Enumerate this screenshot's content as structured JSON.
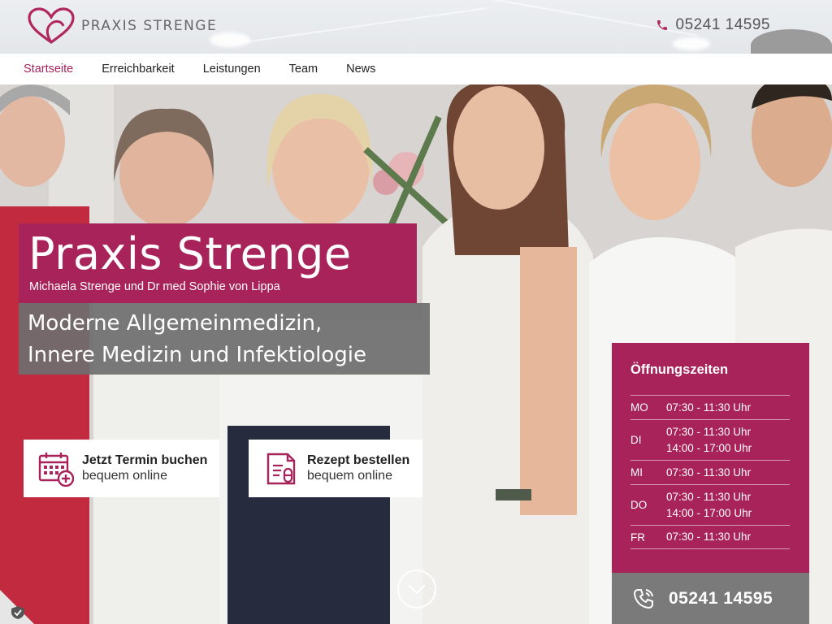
{
  "brand": {
    "name": "PRAXIS STRENGE",
    "accent": "#a8235a",
    "gray": "#6e6e6e"
  },
  "header": {
    "phone": "05241 14595",
    "phone_icon": "phone-icon"
  },
  "nav": {
    "items": [
      {
        "label": "Startseite",
        "active": true
      },
      {
        "label": "Erreichbarkeit",
        "active": false
      },
      {
        "label": "Leistungen",
        "active": false
      },
      {
        "label": "Team",
        "active": false
      },
      {
        "label": "News",
        "active": false
      }
    ]
  },
  "hero": {
    "title": "Praxis Strenge",
    "subtitle": "Michaela Strenge und Dr med Sophie von Lippa",
    "tagline": [
      "Moderne Allgemeinmedizin,",
      "Innere Medizin und Infektiologie"
    ]
  },
  "cta": {
    "appointment": {
      "title": "Jetzt Termin buchen",
      "subtitle": "bequem online",
      "icon": "calendar-plus-icon"
    },
    "prescription": {
      "title": "Rezept bestellen",
      "subtitle": "bequem online",
      "icon": "prescription-icon"
    }
  },
  "hours": {
    "title": "Öffnungszeiten",
    "rows": [
      {
        "day": "MO",
        "times": [
          "07:30 - 11:30 Uhr"
        ]
      },
      {
        "day": "DI",
        "times": [
          "07:30 - 11:30 Uhr",
          "14:00 - 17:00 Uhr"
        ]
      },
      {
        "day": "MI",
        "times": [
          "07:30 - 11:30 Uhr"
        ]
      },
      {
        "day": "DO",
        "times": [
          "07:30 - 11:30 Uhr",
          "14:00 - 17:00 Uhr"
        ]
      },
      {
        "day": "FR",
        "times": [
          "07:30 - 11:30 Uhr"
        ]
      }
    ]
  },
  "phone_box": {
    "number": "05241 14595",
    "icon": "phone-ringing-icon"
  }
}
